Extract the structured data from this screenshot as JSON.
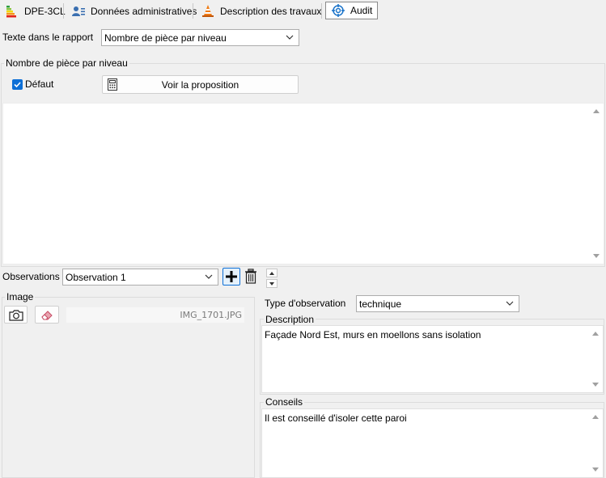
{
  "tabs": [
    {
      "label": "DPE-3CL",
      "icon": "energy-label-icon"
    },
    {
      "label": "Données administratives",
      "icon": "user-card-icon"
    },
    {
      "label": "Description des travaux",
      "icon": "traffic-cone-icon"
    },
    {
      "label": "Audit",
      "icon": "target-icon",
      "active": true
    }
  ],
  "rapport": {
    "label": "Texte dans le rapport",
    "selected": "Nombre de pièce par niveau"
  },
  "group_niveau": {
    "title": "Nombre de pièce par niveau",
    "default_label": "Défaut",
    "default_checked": true,
    "button_label": "Voir la proposition",
    "text": ""
  },
  "observations": {
    "label": "Observations",
    "selected": "Observation 1"
  },
  "image": {
    "title": "Image",
    "filename": "IMG_1701.JPG"
  },
  "observation_type": {
    "label": "Type d'observation",
    "selected": "technique"
  },
  "description": {
    "title": "Description",
    "text": "Façade Nord Est, murs en moellons sans isolation"
  },
  "conseils": {
    "title": "Conseils",
    "text": "Il est conseillé d'isoler cette paroi"
  },
  "colors": {
    "accent": "#0d6fd6",
    "background": "#f0f0f0"
  }
}
